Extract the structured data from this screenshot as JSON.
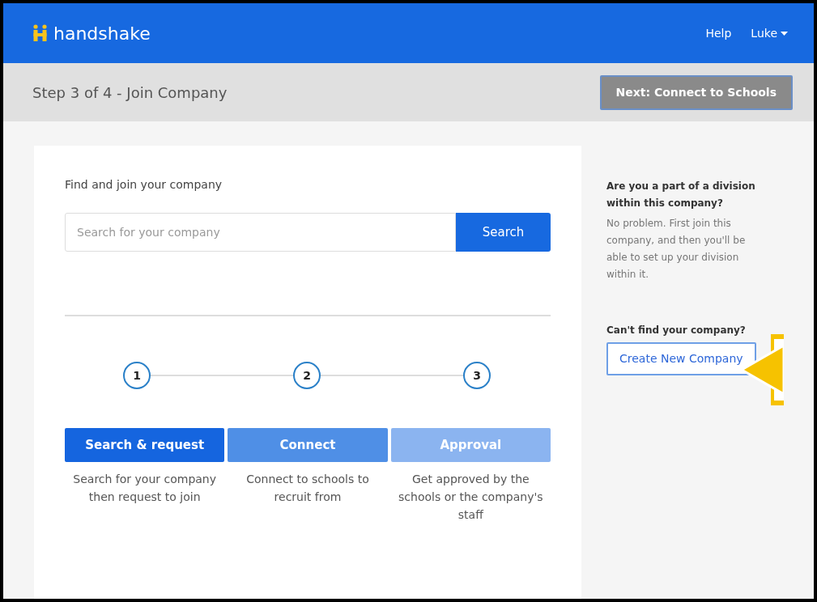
{
  "navbar": {
    "brand": "handshake",
    "links": [
      {
        "label": "Help",
        "dropdown": false
      },
      {
        "label": "Luke",
        "dropdown": true
      }
    ]
  },
  "step_bar": {
    "title": "Step 3 of 4 - Join Company",
    "next_button": "Next: Connect to Schools",
    "next_disabled": true
  },
  "main": {
    "heading": "Find and join your company",
    "search": {
      "placeholder": "Search for your company",
      "button": "Search"
    },
    "steps": [
      {
        "number": "1",
        "label": "Search & request",
        "color": "#1565df",
        "description": "Search for your company then request to join"
      },
      {
        "number": "2",
        "label": "Connect",
        "color": "#4f8fe6",
        "description": "Connect to schools to recruit from"
      },
      {
        "number": "3",
        "label": "Approval",
        "color": "#8bb4f0",
        "description": "Get approved by the schools or the company's staff"
      }
    ]
  },
  "sidebar": {
    "question": "Are you a part of a division within this company?",
    "answer": "No problem. First join this company, and then you'll be able to set up your division within it.",
    "cant_find": "Can't find your company?",
    "create_button": "Create New Company"
  }
}
